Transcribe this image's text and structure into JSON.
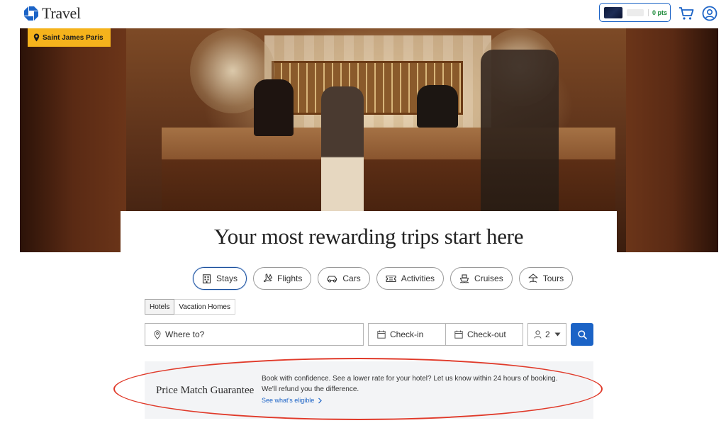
{
  "header": {
    "brand_name": "Travel",
    "points": "0 pts",
    "cart_icon": "cart-icon",
    "account_icon": "account-icon",
    "accent_color": "#1b63c6"
  },
  "hero": {
    "location": "Saint James Paris",
    "headline": "Your most rewarding trips start here"
  },
  "tabs": [
    {
      "label": "Stays",
      "icon": "hotel-icon",
      "active": true
    },
    {
      "label": "Flights",
      "icon": "plane-icon",
      "active": false
    },
    {
      "label": "Cars",
      "icon": "car-icon",
      "active": false
    },
    {
      "label": "Activities",
      "icon": "ticket-icon",
      "active": false
    },
    {
      "label": "Cruises",
      "icon": "ship-icon",
      "active": false
    },
    {
      "label": "Tours",
      "icon": "tour-icon",
      "active": false
    }
  ],
  "subtabs": [
    {
      "label": "Hotels",
      "active": true
    },
    {
      "label": "Vacation Homes",
      "active": false
    }
  ],
  "search": {
    "destination_placeholder": "Where to?",
    "checkin_label": "Check-in",
    "checkout_label": "Check-out",
    "guests": "2"
  },
  "price_match": {
    "title": "Price Match Guarantee",
    "text": "Book with confidence. See a lower rate for your hotel? Let us know within 24 hours of booking. We'll refund you the difference.",
    "link": "See what's eligible"
  }
}
